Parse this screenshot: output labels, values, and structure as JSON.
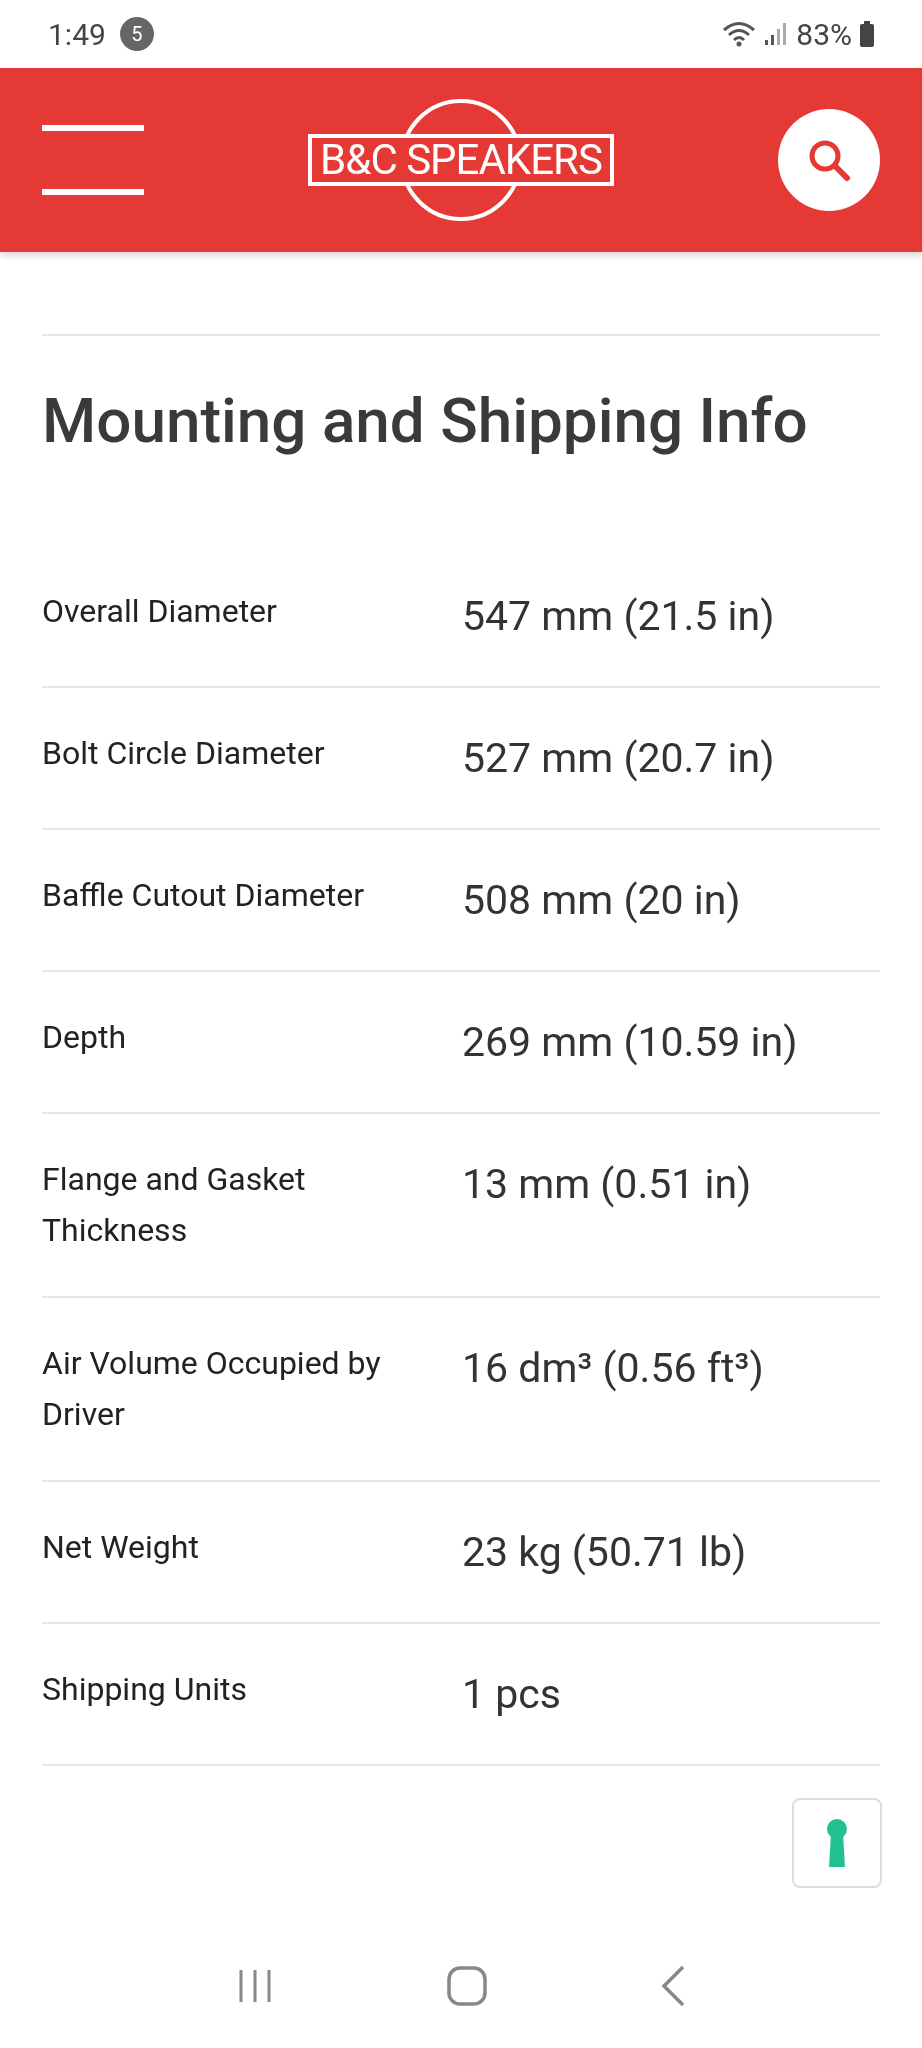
{
  "status_bar": {
    "time": "1:49",
    "notification_count": "5",
    "battery": "83%"
  },
  "header": {
    "logo": "B&C SPEAKERS"
  },
  "section": {
    "title": "Mounting and Shipping Info",
    "rows": [
      {
        "label": "Overall Diameter",
        "value": "547 mm (21.5 in)"
      },
      {
        "label": "Bolt Circle Diameter",
        "value": "527 mm (20.7 in)"
      },
      {
        "label": "Baffle Cutout Diameter",
        "value": "508 mm (20 in)"
      },
      {
        "label": "Depth",
        "value": "269 mm (10.59 in)"
      },
      {
        "label": "Flange and Gasket Thickness",
        "value": "13 mm (0.51 in)"
      },
      {
        "label": "Air Volume Occupied by Driver",
        "value": "16 dm³ (0.56 ft³)"
      },
      {
        "label": "Net Weight",
        "value": "23 kg (50.71 lb)"
      },
      {
        "label": "Shipping Units",
        "value": "1 pcs"
      }
    ]
  }
}
